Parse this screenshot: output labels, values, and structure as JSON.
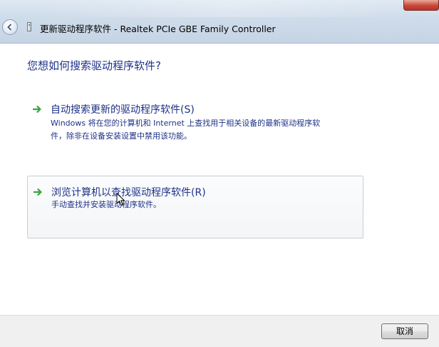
{
  "window": {
    "title": "更新驱动程序软件 - Realtek PCIe GBE Family Controller"
  },
  "icons": {
    "back": "back-arrow-icon",
    "device": "network-device-icon",
    "option_arrow": "green-arrow-icon",
    "cursor": "mouse-pointer-icon"
  },
  "main": {
    "question": "您想如何搜索驱动程序软件?",
    "options": [
      {
        "title": "自动搜索更新的驱动程序软件(S)",
        "description_line1": "Windows 将在您的计算机和 Internet 上查找用于相关设备的最新驱动程序软",
        "description_line2": "件，除非在设备安装设置中禁用该功能。"
      },
      {
        "title": "浏览计算机以查找驱动程序软件(R)",
        "description_line1": "手动查找并安装驱动程序软件。"
      }
    ]
  },
  "footer": {
    "cancel_label": "取消"
  },
  "colors": {
    "link_text": "#1e3287",
    "arrow_green": "#3aa53a",
    "footer_bg": "#f0f0f0"
  }
}
